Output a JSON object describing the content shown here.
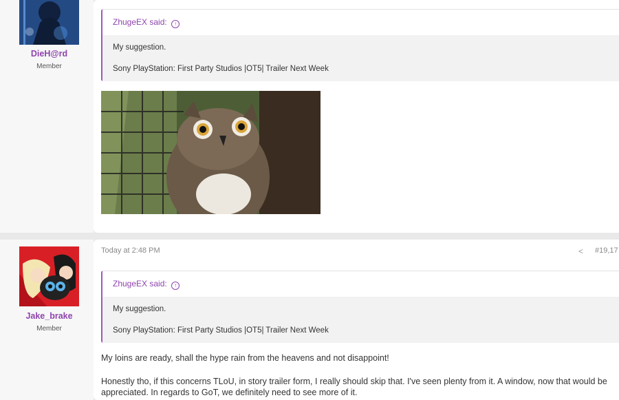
{
  "posts": [
    {
      "username": "DieH@rd",
      "user_title": "Member",
      "quote": {
        "author_label": "ZhugeEX said:",
        "lines": [
          "My suggestion.",
          "Sony PlayStation: First Party Studios |OT5| Trailer Next Week"
        ]
      }
    },
    {
      "username": "Jake_brake",
      "user_title": "Member",
      "timestamp": "Today at 2:48 PM",
      "post_number": "#19,17",
      "quote": {
        "author_label": "ZhugeEX said:",
        "lines": [
          "My suggestion.",
          "Sony PlayStation: First Party Studios |OT5| Trailer Next Week"
        ]
      },
      "body": [
        "My loins are ready, shall the hype rain from the heavens and not disappoint!",
        "Honestly tho, if this concerns TLoU, in story trailer form, I really should skip that. I've seen plenty from it. A window, now that would be appreciated. In regards to GoT, we definitely need to see more of it."
      ]
    }
  ],
  "icons": {
    "quote_jump": "arrow-up-circle-icon",
    "share": "share-icon"
  },
  "colors": {
    "accent": "#8e44ad",
    "quote_bg": "#f2f2f2",
    "page_bg": "#e9e9e9"
  }
}
